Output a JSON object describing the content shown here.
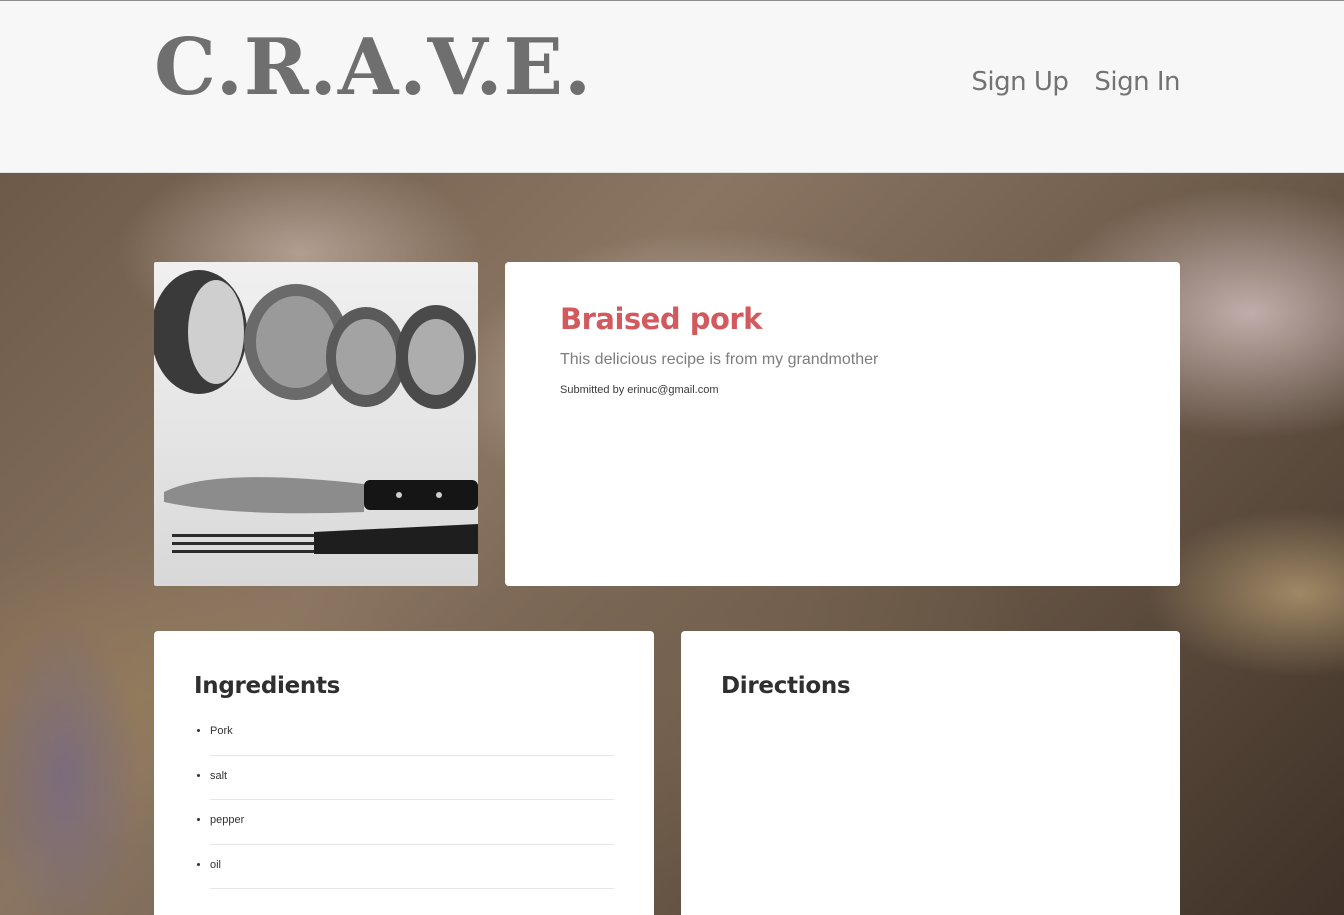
{
  "header": {
    "logo": "C.R.A.V.E.",
    "nav": {
      "sign_up": "Sign Up",
      "sign_in": "Sign In"
    }
  },
  "recipe": {
    "title": "Braised pork",
    "description": "This delicious recipe is from my grandmother",
    "submitted_by": "Submitted by erinuc@gmail.com",
    "image_subject": "sliced pork with knife and fork"
  },
  "ingredients": {
    "heading": "Ingredients",
    "items": [
      "Pork",
      "salt",
      "pepper",
      "oil"
    ]
  },
  "directions": {
    "heading": "Directions"
  },
  "colors": {
    "title_accent": "#d25a5e",
    "logo": "#6f6f6f",
    "header_bg": "#f7f7f7"
  }
}
